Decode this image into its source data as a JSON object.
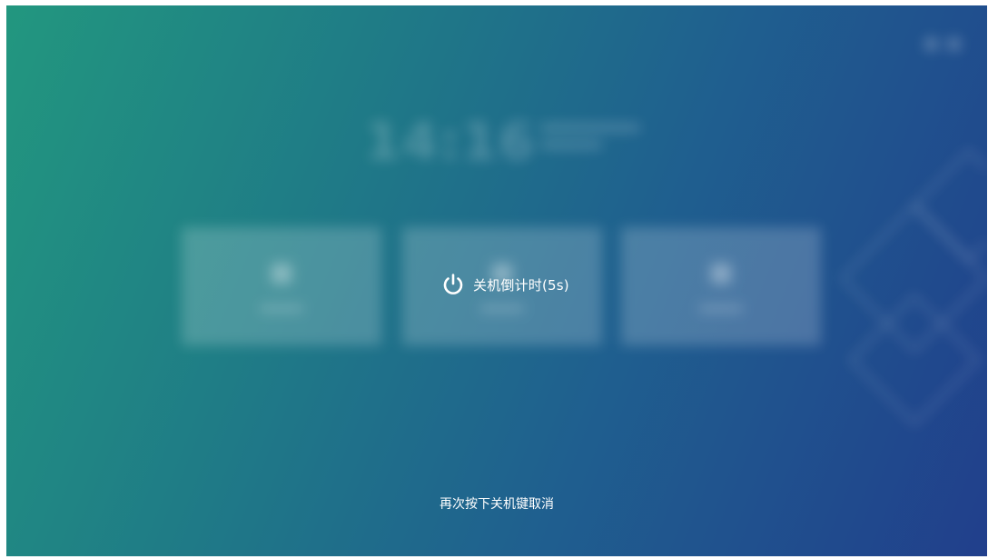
{
  "shutdown_dialog": {
    "countdown_label": "关机倒计时(5s)",
    "cancel_hint": "再次按下关机键取消",
    "icon": "power-icon"
  },
  "background": {
    "clock_time": "14:16",
    "gradient_colors": [
      "#22977f",
      "#1f7d86",
      "#1f5f8f",
      "#213f8c"
    ]
  }
}
